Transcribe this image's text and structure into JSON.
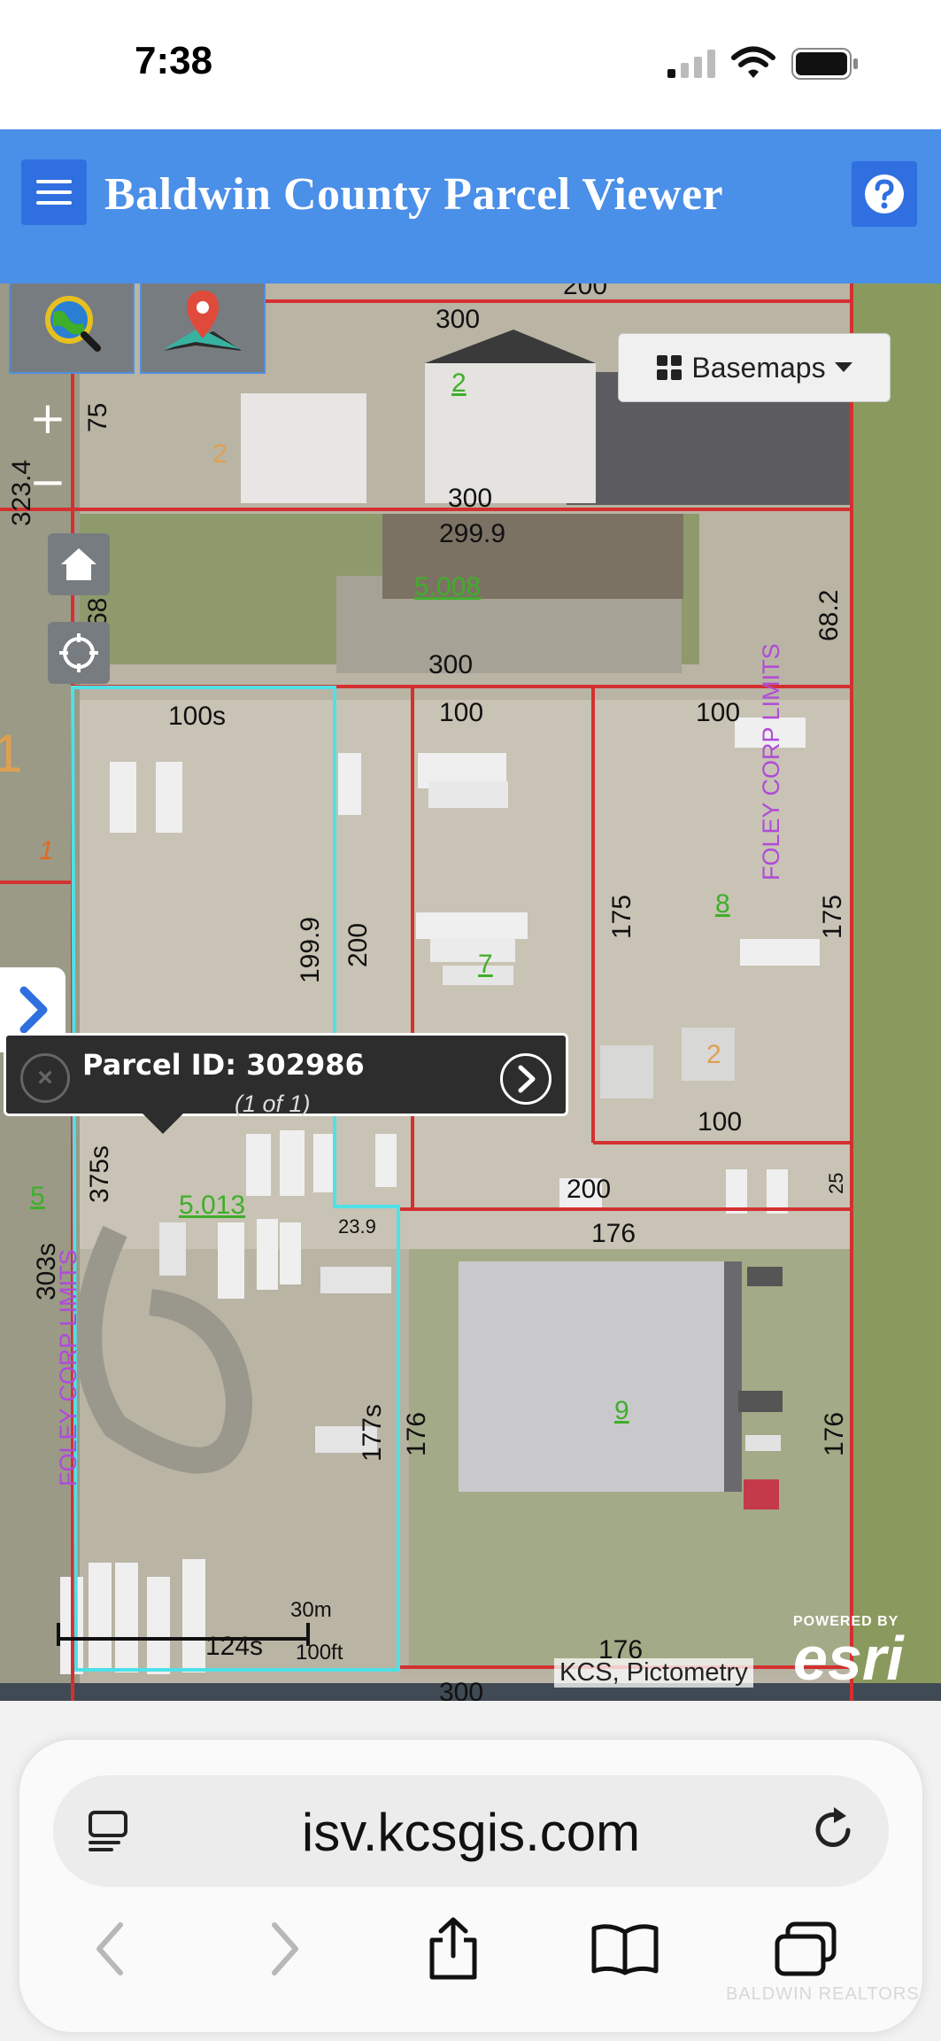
{
  "status_bar": {
    "time": "7:38"
  },
  "header": {
    "title": "Baldwin County Parcel Viewer"
  },
  "map": {
    "basemaps_label": "Basemaps",
    "zoom_in": "+",
    "zoom_out": "−",
    "popup": {
      "title": "Parcel ID: 302986",
      "subtitle": "(1 of 1)"
    },
    "scale": {
      "metric": "30m",
      "imperial": "100ft"
    },
    "attribution": "KCS, Pictometry",
    "esri": {
      "powered_by": "POWERED BY",
      "word": "esri"
    },
    "labels": {
      "l200_top": "200",
      "l300_a": "300",
      "l75": "75",
      "l323": "323.4",
      "l2_green": "2",
      "l2_orange": "2",
      "l300_b": "300",
      "l299": "299.9",
      "l5008": "5.008",
      "l68_left": "68.2",
      "l68_right": "68.2",
      "l300_c": "300",
      "l100s": "100s",
      "l100_a": "100",
      "l100_b": "100",
      "foley_right": "FOLEY CORP LIMITS",
      "l1_orange_big": "1",
      "l1_orange": "1",
      "l1999": "199.9",
      "l200_v": "200",
      "l175_a": "175",
      "l8": "8",
      "l175_b": "175",
      "l7": "7",
      "l2_orange_b": "2",
      "l100_c": "100",
      "l5": "5",
      "l375s": "375s",
      "l5013": "5.013",
      "l239": "23.9",
      "l200_b": "200",
      "l25": "25",
      "l176_a": "176",
      "l303s": "303s",
      "foley_left": "FOLEY CORP LIMITS",
      "l9": "9",
      "l177s": "177s",
      "l176_b": "176",
      "l176_c": "176",
      "l124s": "124s",
      "l176_d": "176",
      "l300_bottom": "300"
    }
  },
  "browser": {
    "url": "isv.kcsgis.com"
  },
  "watermark": "BALDWIN REALTORS"
}
